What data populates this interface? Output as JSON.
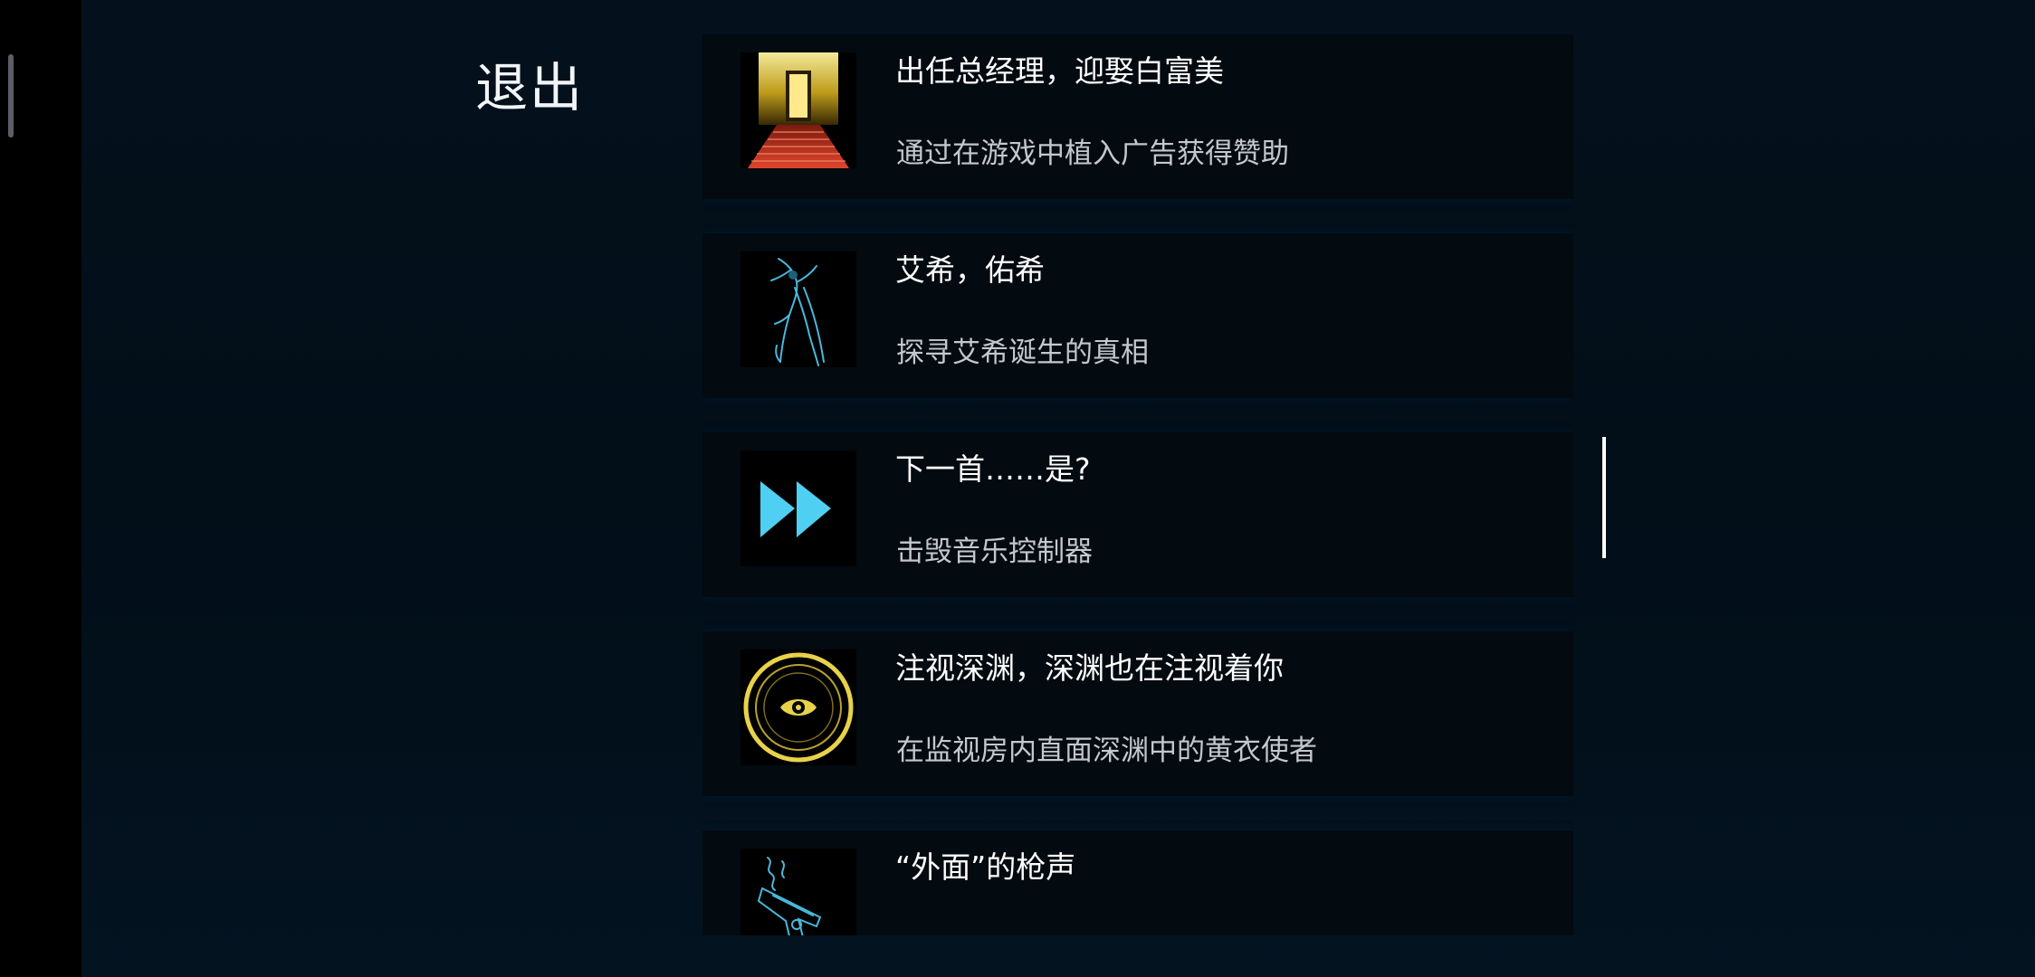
{
  "exit_label": "退出",
  "achievements": [
    {
      "icon": "golden-door-icon",
      "title": "出任总经理，迎娶白富美",
      "description": "通过在游戏中植入广告获得赞助"
    },
    {
      "icon": "scythe-figure-icon",
      "title": "艾希，佑希",
      "description": "探寻艾希诞生的真相"
    },
    {
      "icon": "fast-forward-icon",
      "title": "下一首……是?",
      "description": "击毁音乐控制器"
    },
    {
      "icon": "eye-circle-icon",
      "title": "注视深渊，深渊也在注视着你",
      "description": "在监视房内直面深渊中的黄衣使者"
    },
    {
      "icon": "smoking-gun-icon",
      "title": "“外面”的枪声",
      "description": ""
    }
  ],
  "colors": {
    "background": "#02101b",
    "card": "#030a10",
    "title_text": "#ffffff",
    "desc_text": "#c3c8cc",
    "cyan_accent": "#4fd0f2",
    "gold_accent": "#e8d24a"
  }
}
